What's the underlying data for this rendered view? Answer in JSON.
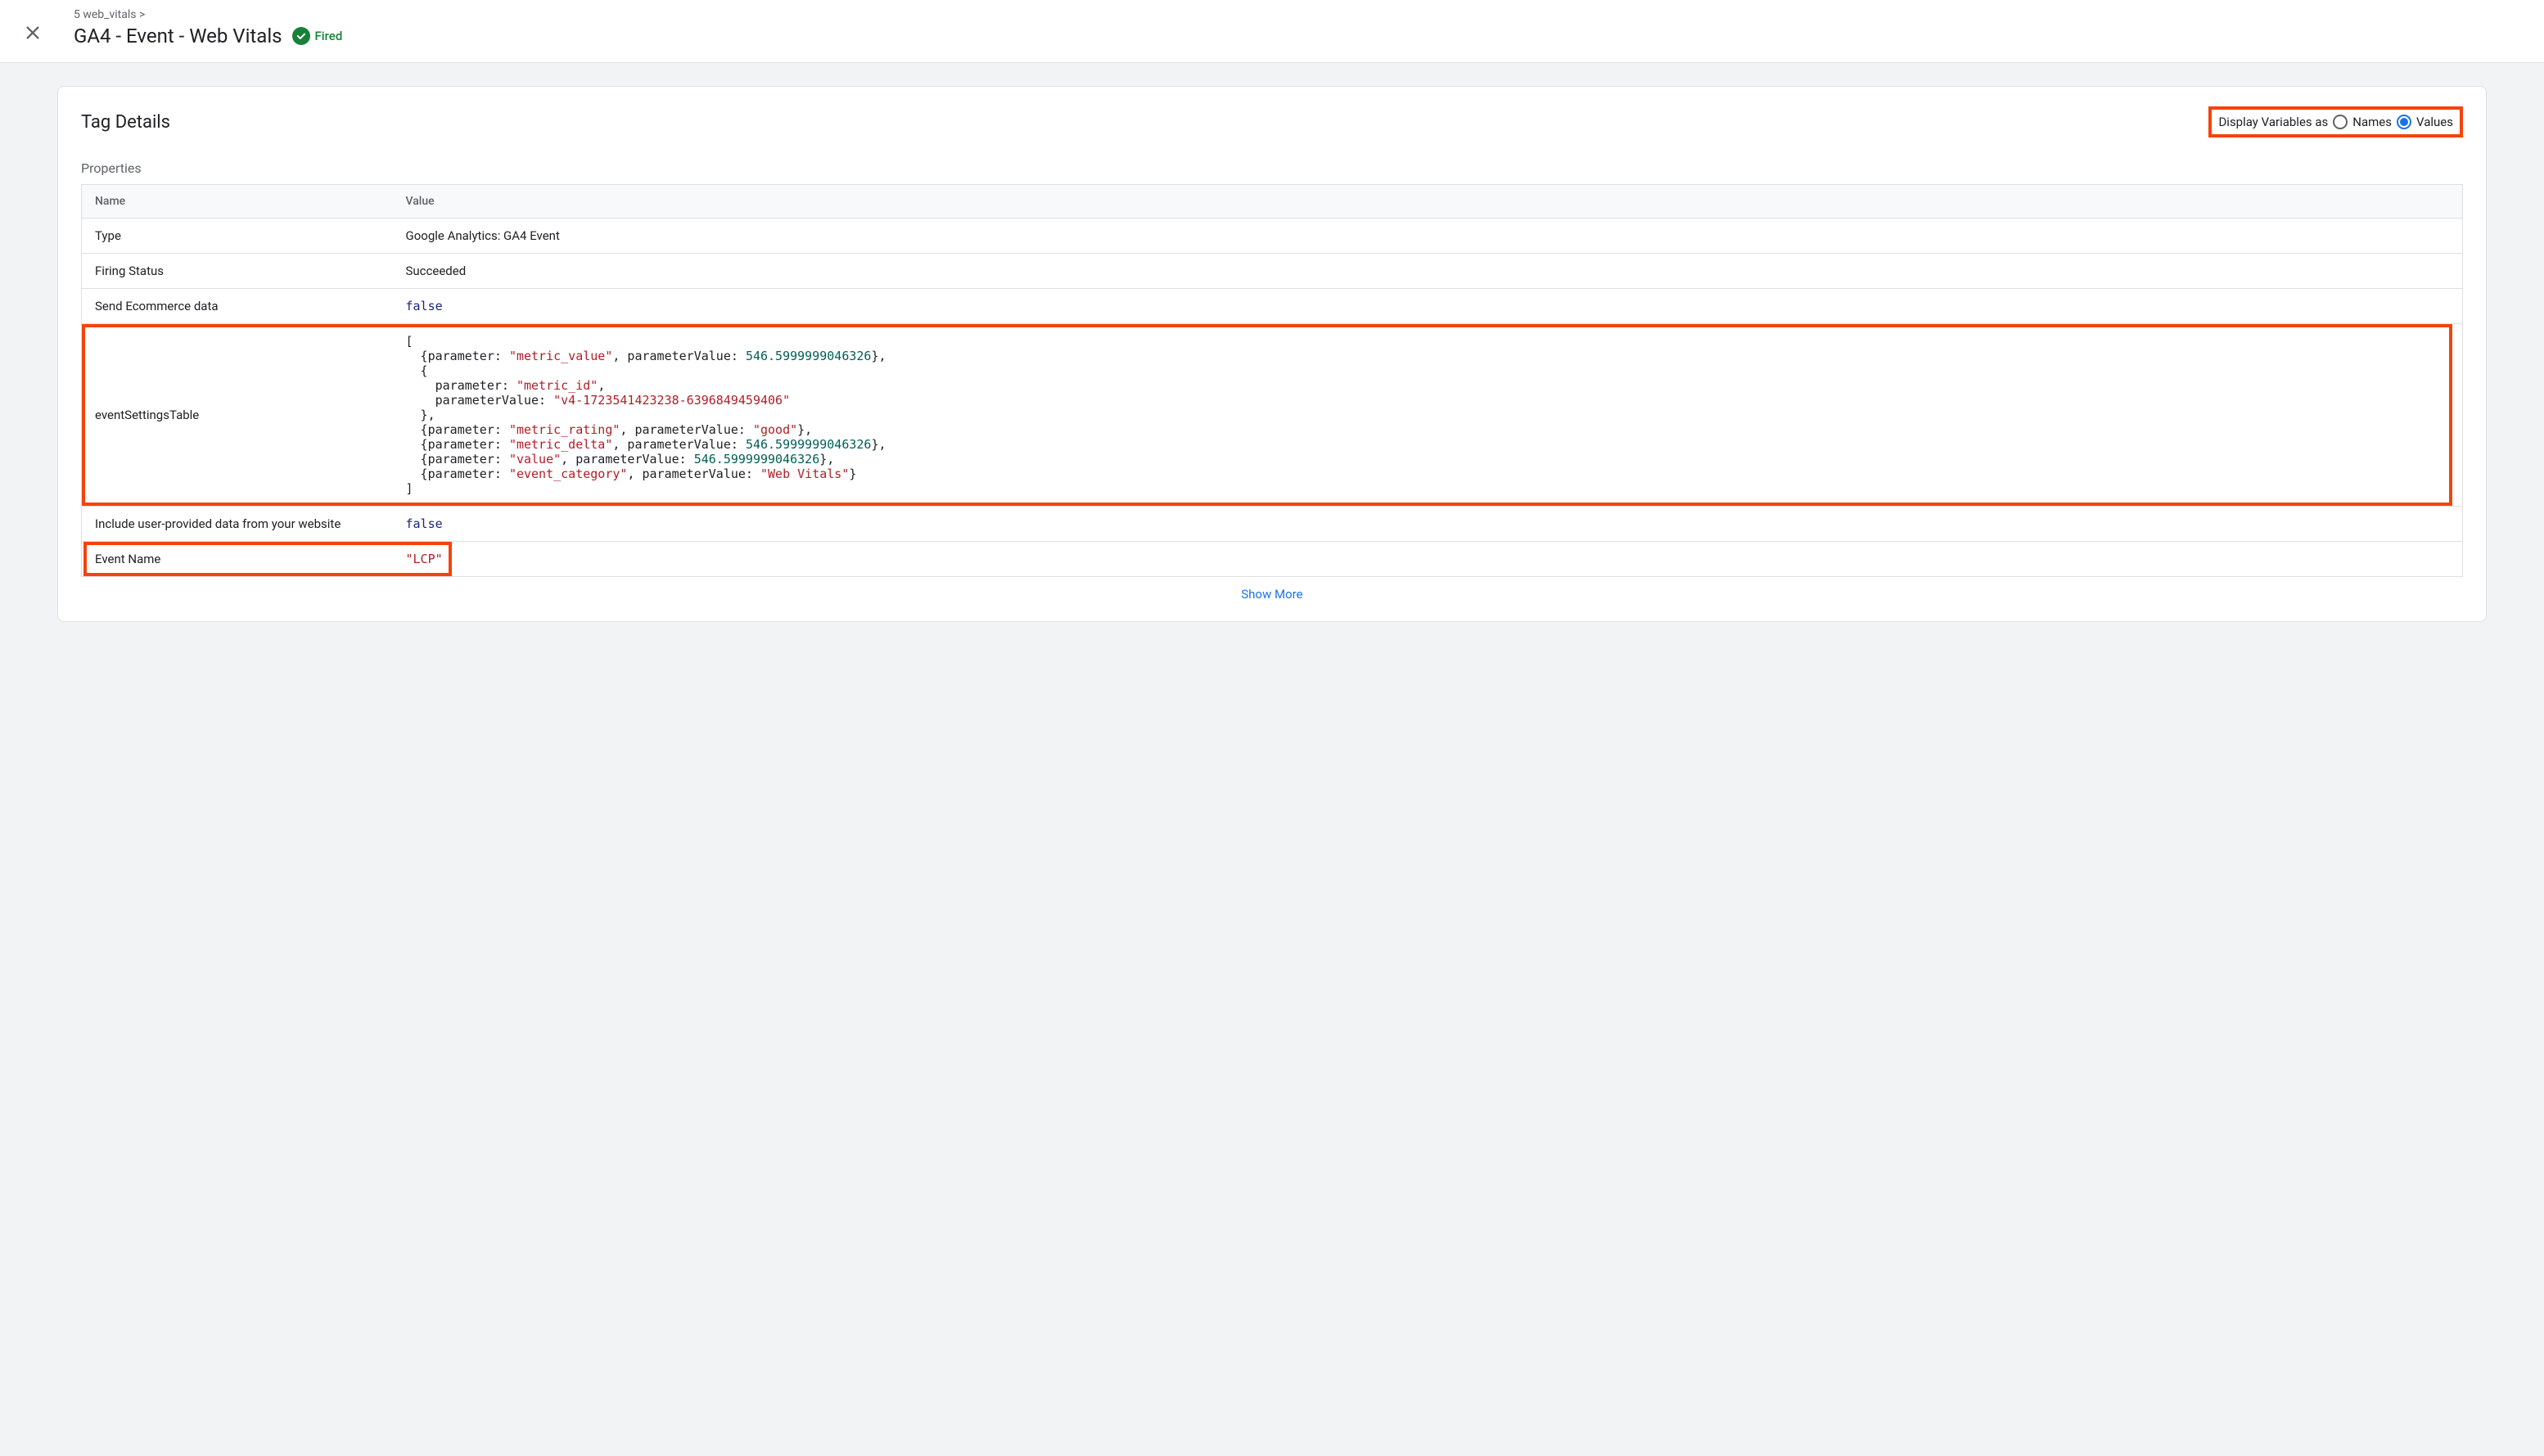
{
  "header": {
    "breadcrumb": "5 web_vitals >",
    "title": "GA4 - Event - Web Vitals",
    "fired_label": "Fired"
  },
  "card": {
    "title": "Tag Details",
    "display_label": "Display Variables as",
    "option_names": "Names",
    "option_values": "Values"
  },
  "section_properties": "Properties",
  "table": {
    "header_name": "Name",
    "header_value": "Value",
    "rows": {
      "type": {
        "name": "Type",
        "value": "Google Analytics: GA4 Event"
      },
      "firing_status": {
        "name": "Firing Status",
        "value": "Succeeded"
      },
      "send_ecommerce": {
        "name": "Send Ecommerce data",
        "value": "false"
      },
      "event_settings": {
        "name": "eventSettingsTable"
      },
      "include_user_data": {
        "name": "Include user-provided data from your website",
        "value": "false"
      },
      "event_name": {
        "name": "Event Name",
        "value": "\"LCP\""
      }
    }
  },
  "event_settings_table": [
    {
      "parameter": "metric_value",
      "parameterValue": 546.5999999046326
    },
    {
      "parameter": "metric_id",
      "parameterValue": "v4-1723541423238-6396849459406"
    },
    {
      "parameter": "metric_rating",
      "parameterValue": "good"
    },
    {
      "parameter": "metric_delta",
      "parameterValue": 546.5999999046326
    },
    {
      "parameter": "value",
      "parameterValue": 546.5999999046326
    },
    {
      "parameter": "event_category",
      "parameterValue": "Web Vitals"
    }
  ],
  "show_more": "Show More"
}
